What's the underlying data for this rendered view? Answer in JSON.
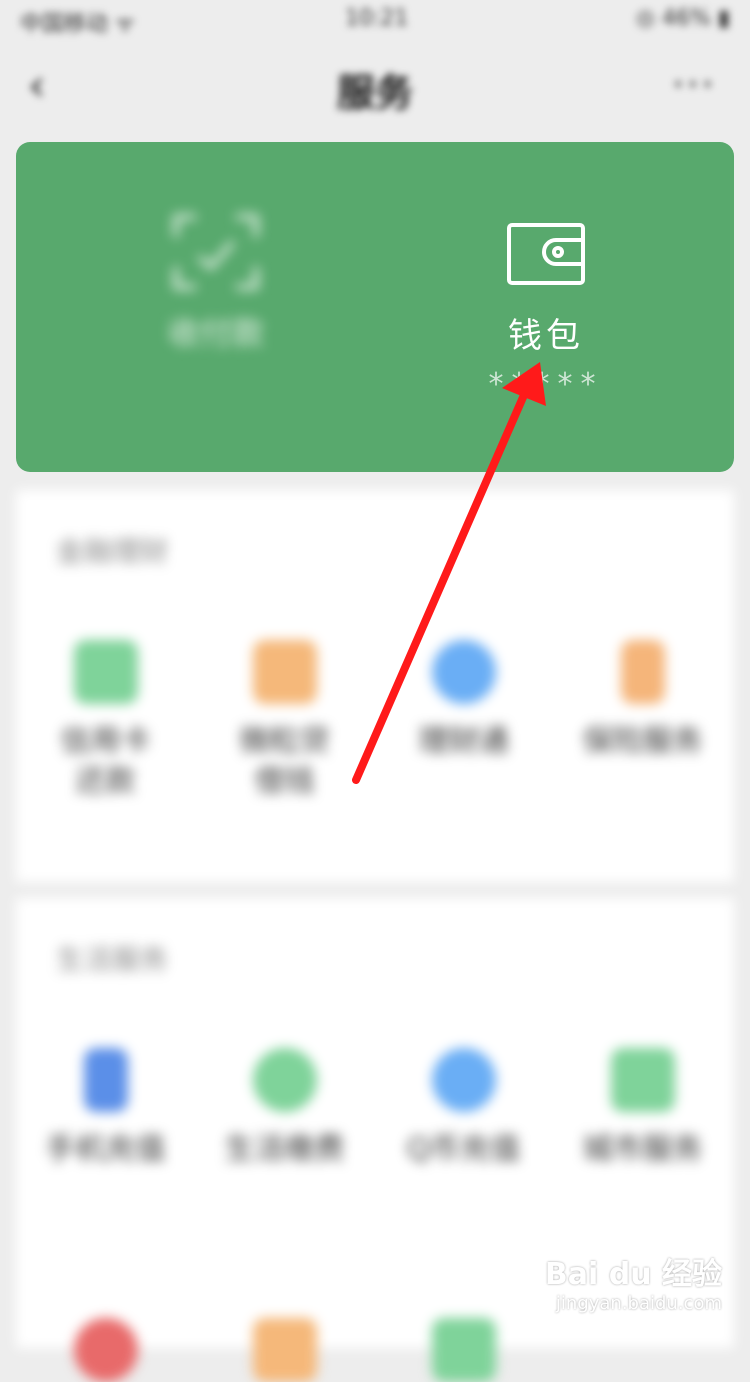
{
  "status_bar": {
    "carrier": "中国移动 ᯤ",
    "time": "10:21",
    "battery": "◎ 46% ▮"
  },
  "nav": {
    "back": "‹",
    "title": "服务",
    "more": "···"
  },
  "card": {
    "pay": {
      "label": "收付款"
    },
    "wallet": {
      "label": "钱包",
      "balance": "*****"
    }
  },
  "section1": {
    "title": "金融理财",
    "items": [
      {
        "label": "信用卡\n还款",
        "color": "#7fd39a"
      },
      {
        "label": "微粒贷\n借钱",
        "color": "#f5b87a"
      },
      {
        "label": "理财通",
        "color": "#6aaef5"
      },
      {
        "label": "保险服务",
        "color": "#f5b57a"
      }
    ]
  },
  "section2": {
    "title": "生活服务",
    "items": [
      {
        "label": "手机充值",
        "color": "#5b8fe8"
      },
      {
        "label": "生活缴费",
        "color": "#7fd39a"
      },
      {
        "label": "Q币充值",
        "color": "#6aaef5"
      },
      {
        "label": "城市服务",
        "color": "#7fd39a"
      }
    ]
  },
  "watermark": {
    "logo": "Bai du 经验",
    "sub": "jingyan.baidu.com"
  }
}
